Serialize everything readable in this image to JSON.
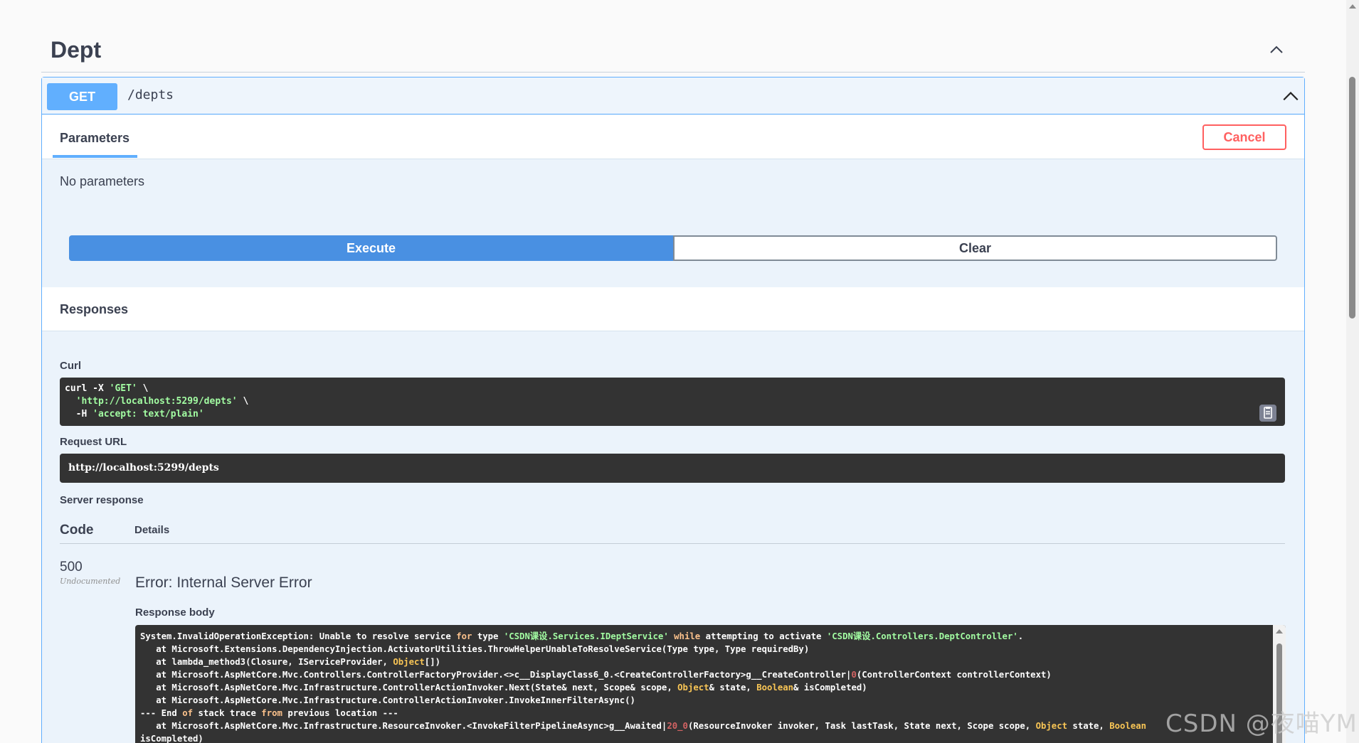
{
  "tag": {
    "title": "Dept"
  },
  "operation": {
    "method": "GET",
    "path": "/depts"
  },
  "parameters": {
    "tab_label": "Parameters",
    "cancel_label": "Cancel",
    "empty_text": "No parameters"
  },
  "actions": {
    "execute_label": "Execute",
    "clear_label": "Clear"
  },
  "responses": {
    "title": "Responses",
    "curl_label": "Curl",
    "curl_lines": [
      {
        "plain": "curl -X ",
        "str": "'GET'",
        "tail": " \\"
      },
      {
        "plain": "  ",
        "str": "'http://localhost:5299/depts'",
        "tail": " \\"
      },
      {
        "plain": "  -H ",
        "str": "'accept: text/plain'",
        "tail": ""
      }
    ],
    "request_url_label": "Request URL",
    "request_url": "http://localhost:5299/depts",
    "server_response_label": "Server response",
    "code_header": "Code",
    "details_header": "Details",
    "code": "500",
    "code_note": "Undocumented",
    "error_title": "Error: Internal Server Error",
    "body_label": "Response body",
    "body_lines": [
      [
        {
          "t": "System.InvalidOperationException: Unable to resolve service "
        },
        {
          "t": "for",
          "c": "kw"
        },
        {
          "t": " type "
        },
        {
          "t": "'CSDN课设.Services.IDeptService'",
          "c": "str"
        },
        {
          "t": " "
        },
        {
          "t": "while",
          "c": "kw"
        },
        {
          "t": " attempting to activate "
        },
        {
          "t": "'CSDN课设.Controllers.DeptController'",
          "c": "str"
        },
        {
          "t": "."
        }
      ],
      [
        {
          "t": "   at Microsoft.Extensions.DependencyInjection.ActivatorUtilities.ThrowHelperUnableToResolveService(Type type, Type requiredBy)"
        }
      ],
      [
        {
          "t": "   at lambda_method3(Closure, IServiceProvider, "
        },
        {
          "t": "Object",
          "c": "ty"
        },
        {
          "t": "[])"
        }
      ],
      [
        {
          "t": "   at Microsoft.AspNetCore.Mvc.Controllers.ControllerFactoryProvider.<>c__DisplayClass6_0.<CreateControllerFactory>g__CreateController|"
        },
        {
          "t": "0",
          "c": "num"
        },
        {
          "t": "(ControllerContext controllerContext)"
        }
      ],
      [
        {
          "t": "   at Microsoft.AspNetCore.Mvc.Infrastructure.ControllerActionInvoker.Next(State& next, Scope& scope, "
        },
        {
          "t": "Object",
          "c": "ty"
        },
        {
          "t": "& state, "
        },
        {
          "t": "Boolean",
          "c": "ty"
        },
        {
          "t": "& isCompleted)"
        }
      ],
      [
        {
          "t": "   at Microsoft.AspNetCore.Mvc.Infrastructure.ControllerActionInvoker.InvokeInnerFilterAsync()"
        }
      ],
      [
        {
          "t": "--- End "
        },
        {
          "t": "of",
          "c": "kw"
        },
        {
          "t": " stack trace "
        },
        {
          "t": "from",
          "c": "kw"
        },
        {
          "t": " previous location ---"
        }
      ],
      [
        {
          "t": "   at Microsoft.AspNetCore.Mvc.Infrastructure.ResourceInvoker.<InvokeFilterPipelineAsync>g__Awaited|"
        },
        {
          "t": "20_0",
          "c": "num"
        },
        {
          "t": "(ResourceInvoker invoker, Task lastTask, State next, Scope scope, "
        },
        {
          "t": "Object",
          "c": "ty"
        },
        {
          "t": " state, "
        },
        {
          "t": "Boolean",
          "c": "ty"
        }
      ],
      [
        {
          "t": "isCompleted)"
        }
      ]
    ]
  },
  "watermark": "CSDN @夜喵YM",
  "colors": {
    "get_accent": "#61affe",
    "execute": "#4990e2",
    "cancel": "#ff6060",
    "code_bg": "#333333"
  }
}
